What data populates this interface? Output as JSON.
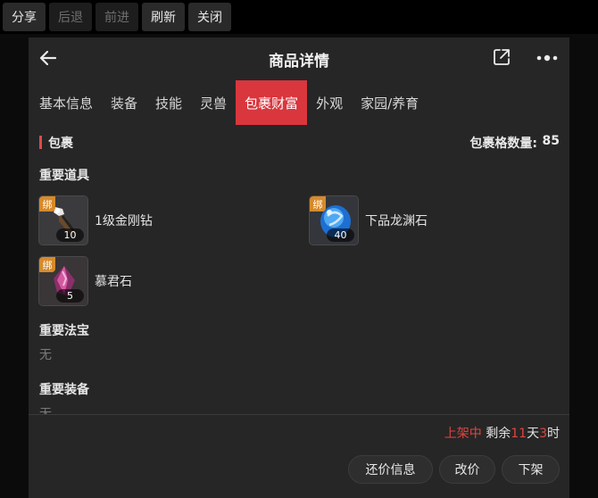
{
  "toolbar": {
    "share": "分享",
    "back": "后退",
    "forward": "前进",
    "refresh": "刷新",
    "close": "关闭"
  },
  "navbar": {
    "title": "商品详情"
  },
  "tabs": [
    {
      "label": "基本信息",
      "active": false
    },
    {
      "label": "装备",
      "active": false
    },
    {
      "label": "技能",
      "active": false
    },
    {
      "label": "灵兽",
      "active": false
    },
    {
      "label": "包裹财富",
      "active": true
    },
    {
      "label": "外观",
      "active": false
    },
    {
      "label": "家园/养育",
      "active": false
    }
  ],
  "pack": {
    "title": "包裹",
    "count_label": "包裹格数量:",
    "count_value": "85"
  },
  "sections": {
    "important_items": {
      "title": "重要道具",
      "items": [
        {
          "name": "1级金刚钻",
          "badge": "绑",
          "qty": "10",
          "icon": "drill-icon"
        },
        {
          "name": "下品龙渊石",
          "badge": "绑",
          "qty": "40",
          "icon": "blue-dragon-stone-icon"
        },
        {
          "name": "慕君石",
          "badge": "绑",
          "qty": "5",
          "icon": "purple-crystal-icon"
        }
      ]
    },
    "important_treasure": {
      "title": "重要法宝",
      "value": "无"
    },
    "important_equipment": {
      "title": "重要装备",
      "value": "无"
    }
  },
  "footer": {
    "status": "上架中",
    "remaining_prefix": "剩余",
    "days": "11",
    "days_unit": "天",
    "hours": "3",
    "hours_unit": "时",
    "buttons": {
      "counter_offer": "还价信息",
      "change_price": "改价",
      "delist": "下架"
    }
  },
  "colors": {
    "accent": "#d9363e",
    "badge": "#d68a2b",
    "panel": "#262626"
  }
}
